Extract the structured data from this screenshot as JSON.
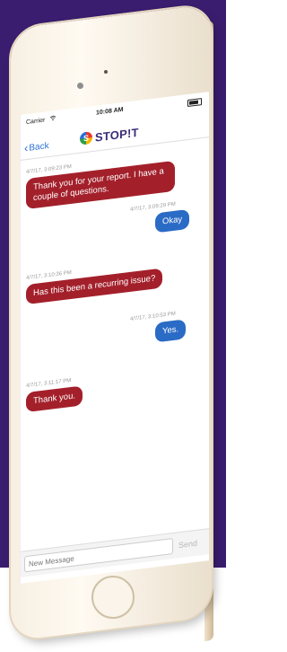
{
  "status_bar": {
    "carrier": "Carrier",
    "time": "10:08 AM"
  },
  "nav": {
    "back_label": "Back",
    "logo_mark": "S",
    "logo_text": "STOP!T"
  },
  "messages": [
    {
      "direction": "in",
      "timestamp": "4/7/17, 3:09:23 PM",
      "text": "Thank you for your report. I have a couple of questions."
    },
    {
      "direction": "out",
      "timestamp": "4/7/17, 3:09:29 PM",
      "text": "Okay"
    },
    {
      "direction": "in",
      "timestamp": "4/7/17, 3:10:36 PM",
      "text": "Has this been a recurring issue?"
    },
    {
      "direction": "out",
      "timestamp": "4/7/17, 3:10:53 PM",
      "text": "Yes."
    },
    {
      "direction": "in",
      "timestamp": "4/7/17, 3:11:17 PM",
      "text": "Thank you."
    }
  ],
  "composer": {
    "placeholder": "New Message",
    "send_label": "Send"
  },
  "colors": {
    "background": "#3a1d6e",
    "incoming_bubble": "#a3202b",
    "outgoing_bubble": "#2a6bc5",
    "link": "#2b6fd6"
  }
}
